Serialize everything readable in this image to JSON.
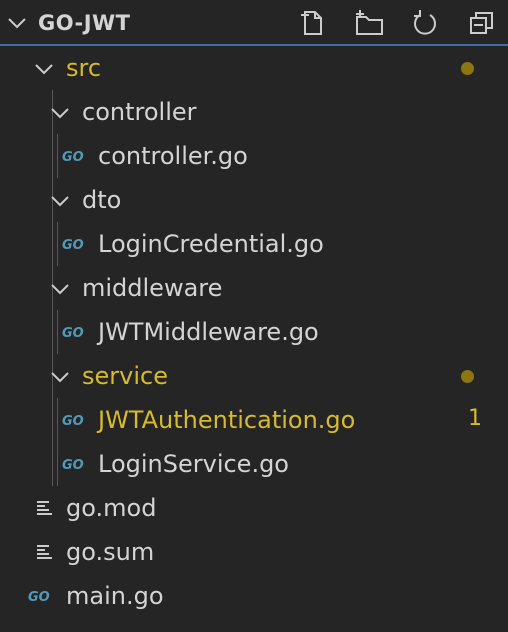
{
  "explorer": {
    "title": "GO-JWT",
    "actions": [
      {
        "name": "new-file-icon"
      },
      {
        "name": "new-folder-icon"
      },
      {
        "name": "refresh-icon"
      },
      {
        "name": "collapse-all-icon"
      }
    ]
  },
  "tree": {
    "src": "src",
    "controller_folder": "controller",
    "controller_file": "controller.go",
    "dto_folder": "dto",
    "login_credential": "LoginCredential.go",
    "middleware_folder": "middleware",
    "jwt_middleware": "JWTMiddleware.go",
    "service_folder": "service",
    "jwt_authentication": "JWTAuthentication.go",
    "jwt_authentication_problems": "1",
    "login_service": "LoginService.go",
    "go_mod": "go.mod",
    "go_sum": "go.sum",
    "main_go": "main.go"
  },
  "colors": {
    "modified": "#d7ba2d",
    "go_icon": "#519aba",
    "background": "#252526"
  }
}
